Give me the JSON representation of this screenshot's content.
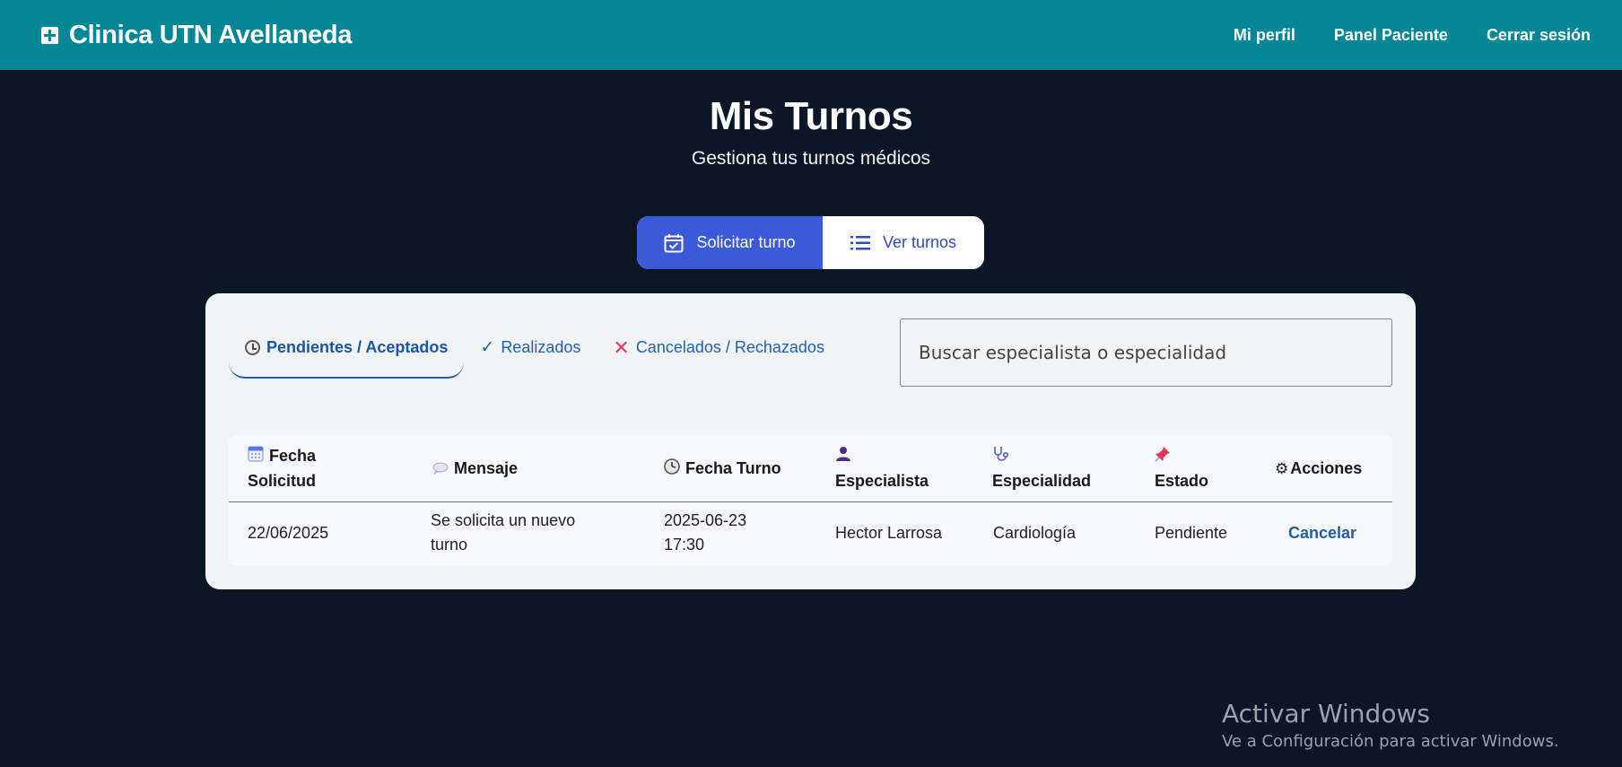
{
  "navbar": {
    "brand_title": "Clinica UTN Avellaneda",
    "links": [
      "Mi perfil",
      "Panel Paciente",
      "Cerrar sesión"
    ]
  },
  "hero": {
    "title": "Mis Turnos",
    "subtitle": "Gestiona tus turnos médicos"
  },
  "toggle": {
    "request_label": "Solicitar turno",
    "view_label": "Ver turnos"
  },
  "filters": {
    "tabs": [
      "Pendientes / Aceptados",
      "Realizados",
      "Cancelados / Rechazados"
    ],
    "check_glyph": "✓",
    "x_glyph": "✕",
    "search_placeholder": "Buscar especialista o especialidad"
  },
  "table": {
    "headers": {
      "fecha_solicitud_1": "Fecha",
      "fecha_solicitud_2": "Solicitud",
      "mensaje": "Mensaje",
      "fecha_turno": "Fecha Turno",
      "especialista": "Especialista",
      "especialidad": "Especialidad",
      "estado": "Estado",
      "acciones": "Acciones"
    },
    "gear_glyph": "⚙",
    "rows": [
      {
        "fecha_solicitud": "22/06/2025",
        "mensaje_1": "Se solicita un nuevo",
        "mensaje_2": "turno",
        "fecha_turno_1": "2025-06-23",
        "fecha_turno_2": "17:30",
        "especialista": "Hector Larrosa",
        "especialidad": "Cardiología",
        "estado": "Pendiente",
        "accion": "Cancelar"
      }
    ]
  },
  "watermark": {
    "line1": "Activar Windows",
    "line2": "Ve a Configuración para activar Windows."
  },
  "colors": {
    "navbar": "#078696",
    "background": "#0b1626",
    "primary": "#3a5ad9",
    "link": "#1f5fa6"
  }
}
